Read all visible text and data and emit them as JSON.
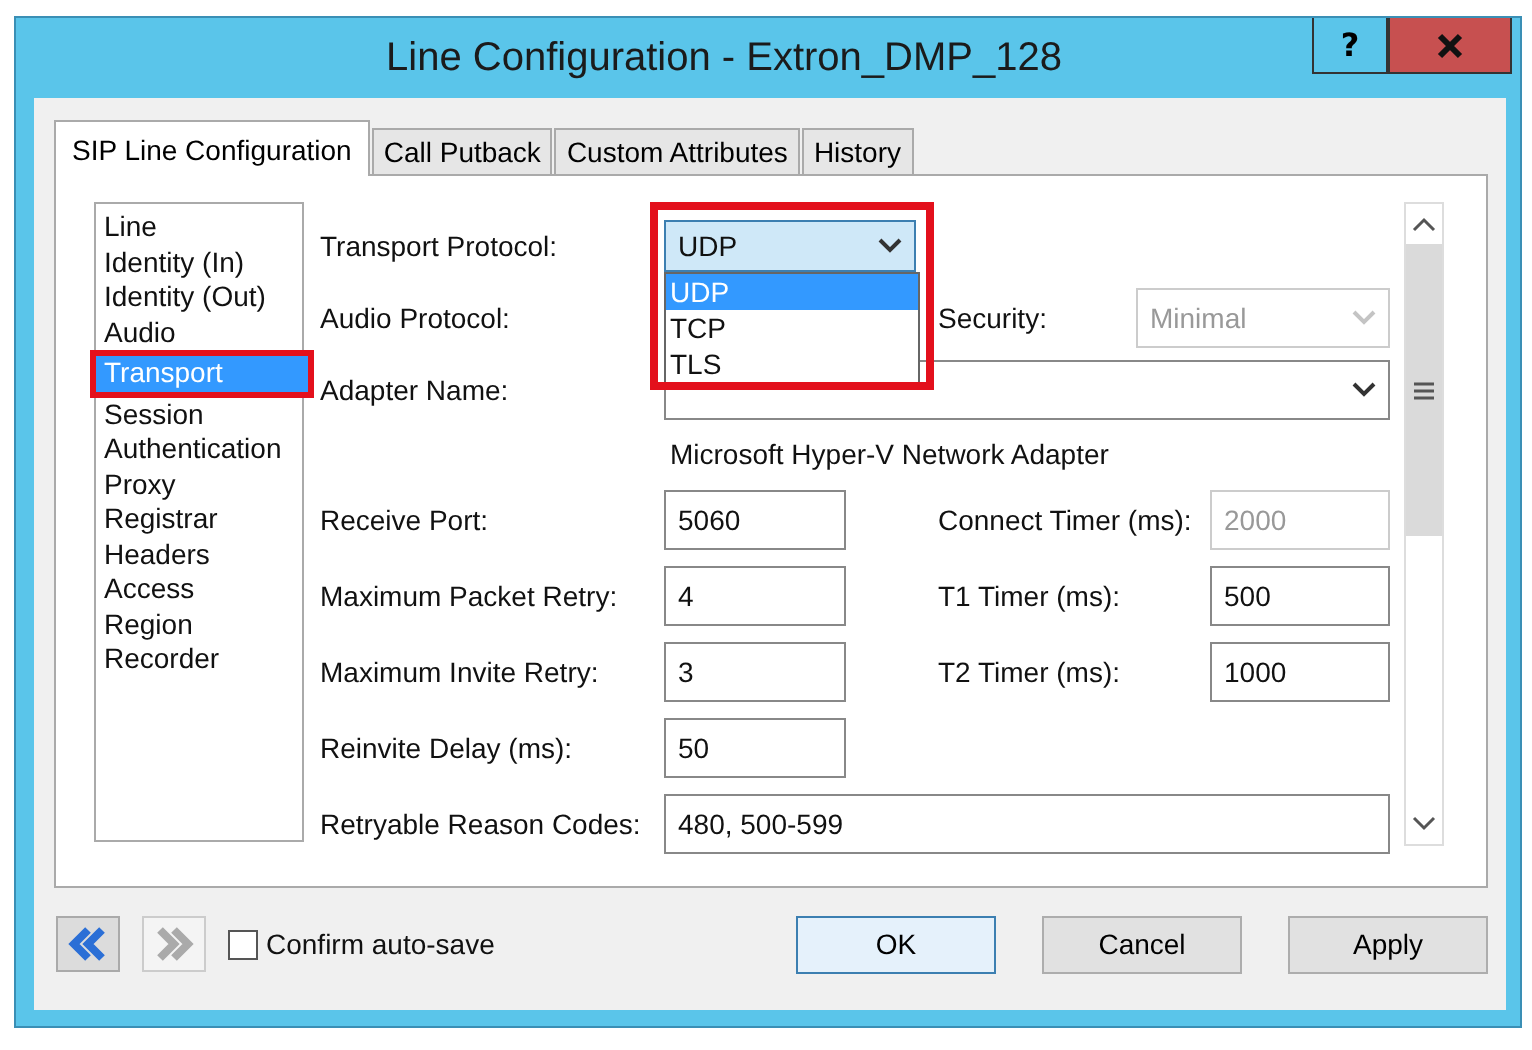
{
  "window": {
    "title": "Line Configuration - Extron_DMP_128",
    "help_label": "?"
  },
  "tabs": [
    {
      "label": "SIP Line Configuration",
      "selected": true
    },
    {
      "label": "Call Putback",
      "selected": false
    },
    {
      "label": "Custom Attributes",
      "selected": false
    },
    {
      "label": "History",
      "selected": false
    }
  ],
  "nav_list": [
    {
      "label": "Line",
      "selected": false,
      "annotated": false
    },
    {
      "label": "Identity (In)",
      "selected": false,
      "annotated": false
    },
    {
      "label": "Identity (Out)",
      "selected": false,
      "annotated": false
    },
    {
      "label": "Audio",
      "selected": false,
      "annotated": false
    },
    {
      "label": "Transport",
      "selected": true,
      "annotated": true
    },
    {
      "label": "Session",
      "selected": false,
      "annotated": false
    },
    {
      "label": "Authentication",
      "selected": false,
      "annotated": false
    },
    {
      "label": "Proxy",
      "selected": false,
      "annotated": false
    },
    {
      "label": "Registrar",
      "selected": false,
      "annotated": false
    },
    {
      "label": "Headers",
      "selected": false,
      "annotated": false
    },
    {
      "label": "Access",
      "selected": false,
      "annotated": false
    },
    {
      "label": "Region",
      "selected": false,
      "annotated": false
    },
    {
      "label": "Recorder",
      "selected": false,
      "annotated": false
    }
  ],
  "form": {
    "transport_protocol": {
      "label": "Transport Protocol:",
      "value": "UDP",
      "expanded": true,
      "annotated": true,
      "options": [
        {
          "label": "UDP",
          "selected": true
        },
        {
          "label": "TCP",
          "selected": false
        },
        {
          "label": "TLS",
          "selected": false
        }
      ]
    },
    "audio_protocol": {
      "label": "Audio Protocol:"
    },
    "security": {
      "label": "Security:",
      "value": "Minimal",
      "disabled": true
    },
    "adapter_name": {
      "label": "Adapter Name:"
    },
    "adapter_description": "Microsoft Hyper-V Network Adapter",
    "rows": [
      {
        "label": "Receive Port:",
        "value": "5060",
        "right_label": "Connect Timer (ms):",
        "right_value": "2000",
        "right_disabled": true
      },
      {
        "label": "Maximum Packet Retry:",
        "value": "4",
        "right_label": "T1 Timer (ms):",
        "right_value": "500",
        "right_disabled": false
      },
      {
        "label": "Maximum Invite Retry:",
        "value": "3",
        "right_label": "T2 Timer (ms):",
        "right_value": "1000",
        "right_disabled": false
      },
      {
        "label": "Reinvite Delay (ms):",
        "value": "50"
      }
    ],
    "reason_codes": {
      "label": "Retryable Reason Codes:",
      "value": "480, 500-599"
    }
  },
  "footer": {
    "back_disabled": false,
    "forward_disabled": true,
    "confirm_autosave": {
      "label": "Confirm auto-save",
      "checked": false
    },
    "buttons": [
      {
        "label": "OK",
        "default": true
      },
      {
        "label": "Cancel",
        "default": false
      },
      {
        "label": "Apply",
        "default": false
      }
    ]
  }
}
